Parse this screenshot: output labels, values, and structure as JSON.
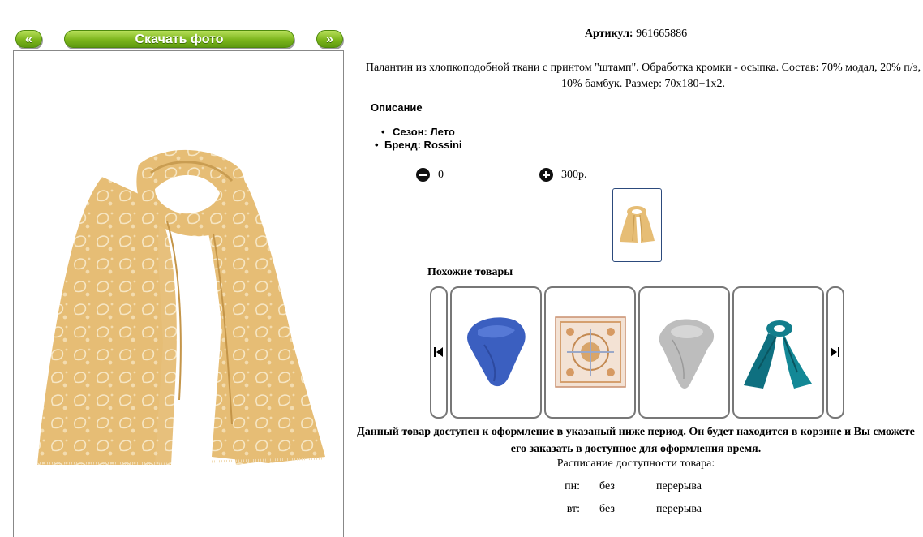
{
  "nav": {
    "prev_label": "«",
    "download_label": "Скачать фото",
    "next_label": "»"
  },
  "product": {
    "article_label": "Артикул:",
    "article_value": "961665886",
    "description": "Палантин из хлопкоподобной ткани с принтом \"штамп\". Обработка кромки - осыпка. Состав: 70% модал, 20% п/э, 10% бамбук. Размер: 70х180+1х2.",
    "section_title": "Описание",
    "props": [
      "Сезон: Лето",
      "Бренд: Rossini"
    ],
    "quantity": "0",
    "price": "300р.",
    "image_color": "#e6bd75"
  },
  "similar": {
    "title": "Похожие товары",
    "items": [
      {
        "name": "blue-scarf",
        "color": "#3b5fc0"
      },
      {
        "name": "pattern-scarf",
        "color": "#d8a56a"
      },
      {
        "name": "grey-scarf",
        "color": "#b8b8b8"
      },
      {
        "name": "teal-scarf",
        "color": "#127e8c"
      }
    ]
  },
  "availability": {
    "notice": "Данный товар доступен к оформление в указаный ниже период. Он будет находится в корзине и Вы сможете его заказать в доступное для оформления время.",
    "title": "Расписание доступности товара:",
    "rows": [
      {
        "day": "пн:",
        "a": "без",
        "b": "перерыва"
      },
      {
        "day": "вт:",
        "a": "без",
        "b": "перерыва"
      },
      {
        "day": "",
        "a": "",
        "b": ""
      }
    ]
  }
}
